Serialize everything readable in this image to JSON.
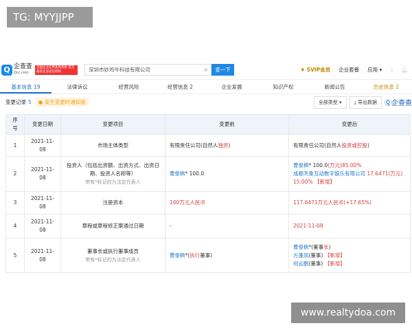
{
  "watermarks": {
    "top": "TG: MYYJJPP",
    "bottom": "www.realtydoa.com"
  },
  "header": {
    "logo_text": "企查查",
    "logo_sub": "Qcc.com",
    "badge": "全国企业信用查询系统 官方备案企业征信机构",
    "search_value": "深圳市妙鸡牛科技有限公司",
    "search_button": "查一下",
    "svip": "SVIP会员",
    "package": "企业套餐",
    "apps": "应用"
  },
  "nav": [
    {
      "label": "基本信息",
      "count": "19"
    },
    {
      "label": "法律诉讼"
    },
    {
      "label": "经营风险"
    },
    {
      "label": "经营信息",
      "count": "2"
    },
    {
      "label": "企业发展"
    },
    {
      "label": "知识产权"
    },
    {
      "label": "新闻公告"
    },
    {
      "label": "历史信息",
      "count": "2"
    }
  ],
  "section": {
    "title": "变更记录",
    "count": "5",
    "notify": "发生变更时通知我",
    "filter": "全部类型",
    "export": "导出数据",
    "brand": "企查查"
  },
  "table": {
    "headers": [
      "序号",
      "变更日期",
      "变更项目",
      "变更前",
      "变更后"
    ],
    "rows": [
      {
        "no": "1",
        "date": "2021-11-08",
        "item": "市场主体类型",
        "before": [
          {
            "t": "有限责任公司(自然人"
          },
          {
            "t": "独资",
            "c": "red"
          },
          {
            "t": ")"
          }
        ],
        "after": [
          [
            {
              "t": "有限责任公司(自然人"
            },
            {
              "t": "投资或控股",
              "c": "red"
            },
            {
              "t": ")"
            }
          ]
        ]
      },
      {
        "no": "2",
        "date": "2021-11-08",
        "item": "投资人（包括出资额、出资方式、出资日期、投资人名称等）",
        "note": "带有*标记的为法定代表人",
        "before": [
          {
            "t": "曹俊枫",
            "c": "blue"
          },
          {
            "t": "* 100.0"
          }
        ],
        "after": [
          [
            {
              "t": "曹俊枫",
              "c": "blue"
            },
            {
              "t": "* 100.0"
            },
            {
              "t": "(万元)85.00%",
              "c": "red"
            }
          ],
          [
            {
              "t": "成都天象互动数字娱乐有限公司",
              "c": "blue"
            },
            {
              "t": " 17.6471(万元)",
              "c": "red"
            }
          ],
          [
            {
              "t": "15.00% 【新增】",
              "c": "red"
            }
          ]
        ]
      },
      {
        "no": "3",
        "date": "2021-11-08",
        "item": "注册资本",
        "before": [
          {
            "t": "100万元人民币",
            "c": "red"
          }
        ],
        "after": [
          [
            {
              "t": "117.6471万元人民币(+17.65%)",
              "c": "red"
            }
          ]
        ]
      },
      {
        "no": "4",
        "date": "2021-11-08",
        "item": "章程或章程修正案通过日期",
        "before": [
          {
            "t": "-"
          }
        ],
        "after": [
          [
            {
              "t": "2021-11-08",
              "c": "red"
            }
          ]
        ]
      },
      {
        "no": "5",
        "date": "2021-11-08",
        "item": "董事长或执行董事成员",
        "note": "带有*标记的为法定代表人",
        "before": [
          {
            "t": "曹俊枫",
            "c": "blue"
          },
          {
            "t": "*("
          },
          {
            "t": "执行",
            "c": "red"
          },
          {
            "t": "董事)"
          }
        ],
        "after": [
          [
            {
              "t": "曹俊枫",
              "c": "blue"
            },
            {
              "t": "*(董事"
            },
            {
              "t": "长",
              "c": "red"
            },
            {
              "t": ")"
            }
          ],
          [
            {
              "t": "方蓬凤",
              "c": "blue"
            },
            {
              "t": "(董事) "
            },
            {
              "t": "【新增】",
              "c": "red"
            }
          ],
          [
            {
              "t": "何云鹏",
              "c": "blue"
            },
            {
              "t": "(董事) "
            },
            {
              "t": "【新增】",
              "c": "red"
            }
          ]
        ]
      }
    ]
  }
}
